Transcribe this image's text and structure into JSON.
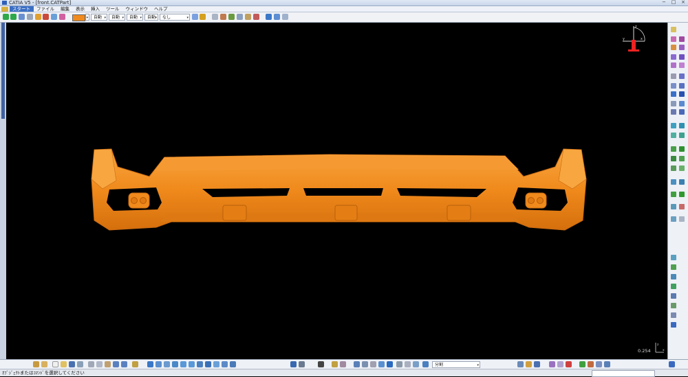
{
  "window": {
    "title": "CATIA V5 - [front.CATPart]",
    "buttons": [
      "−",
      "□",
      "×"
    ]
  },
  "menubar": {
    "items": [
      "スタート",
      "ファイル",
      "編集",
      "表示",
      "挿入",
      "ツール",
      "ウィンドウ",
      "ヘルプ"
    ]
  },
  "toolbar": {
    "color_value": "#F08A1C",
    "transparency": "自動",
    "line_thickness": "自動",
    "line_type": "自動",
    "point_type": "自動",
    "layer_label": "なし",
    "layer_prefix": "自動"
  },
  "viewport": {
    "background": "#000000",
    "part_color": "#F08A1C",
    "compass_labels": [
      "z",
      "x",
      "y"
    ],
    "scale_value": "0.254",
    "scale_axis_labels": [
      "z",
      "x"
    ]
  },
  "bottom_toolbar": {
    "dropdown_value": "分割"
  },
  "status": {
    "message": "ｵﾌﾞｼﾞｪｸﾄまたはｺﾏﾝﾄﾞを選択してください"
  }
}
